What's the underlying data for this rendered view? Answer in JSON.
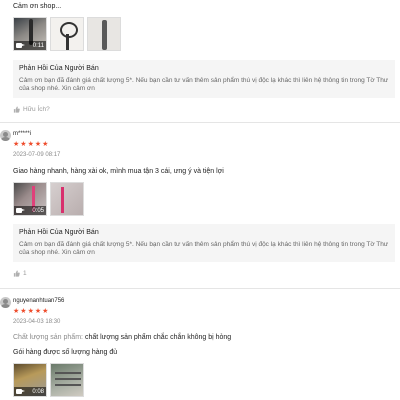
{
  "reviews": [
    {
      "comment": "Cảm ơn shop...",
      "media": [
        {
          "kind": "video",
          "duration": "0:11"
        },
        {
          "kind": "image"
        },
        {
          "kind": "image"
        }
      ],
      "seller_reply": {
        "title": "Phản Hồi Của Người Bán",
        "text": "Cảm ơn bạn đã đánh giá chất lượng 5*. Nếu bạn cần tư vấn thêm sản phẩm thú vị độc lạ khác thì liên hệ thông tin trong Tờ Thư của shop nhé. Xin cảm ơn"
      },
      "helpful": "Hữu Ích?"
    },
    {
      "username": "m*****i",
      "rating": 5,
      "timestamp": "2023-07-09 08:17",
      "comment": "Giao hàng nhanh, hàng xài ok, mình mua tận 3 cái, ưng ý và tiện lợi",
      "media": [
        {
          "kind": "video",
          "duration": "0:05"
        },
        {
          "kind": "image"
        }
      ],
      "seller_reply": {
        "title": "Phản Hồi Của Người Bán",
        "text": "Cảm ơn bạn đã đánh giá chất lượng 5*. Nếu bạn cần tư vấn thêm sản phẩm thú vị độc lạ khác thì liên hệ thông tin trong Tờ Thư của shop nhé. Xin cảm ơn"
      },
      "helpful_count": "1"
    },
    {
      "username": "nguyenanhtuan756",
      "rating": 5,
      "timestamp": "2023-04-03 18:30",
      "attribute_label": "Chất lượng sản phẩm:",
      "attribute_value": "chất lượng sản phẩm chắc chắn không bị hỏng",
      "comment": "Gói hàng được số lượng hàng đủ",
      "media": [
        {
          "kind": "video",
          "duration": "0:08"
        },
        {
          "kind": "image"
        }
      ]
    }
  ],
  "colors": {
    "star": "#ee4d2d",
    "reply_bg": "#f5f5f5"
  },
  "icons": {
    "video": "video-camera-icon",
    "star": "star-icon",
    "like": "thumbs-up-icon"
  }
}
